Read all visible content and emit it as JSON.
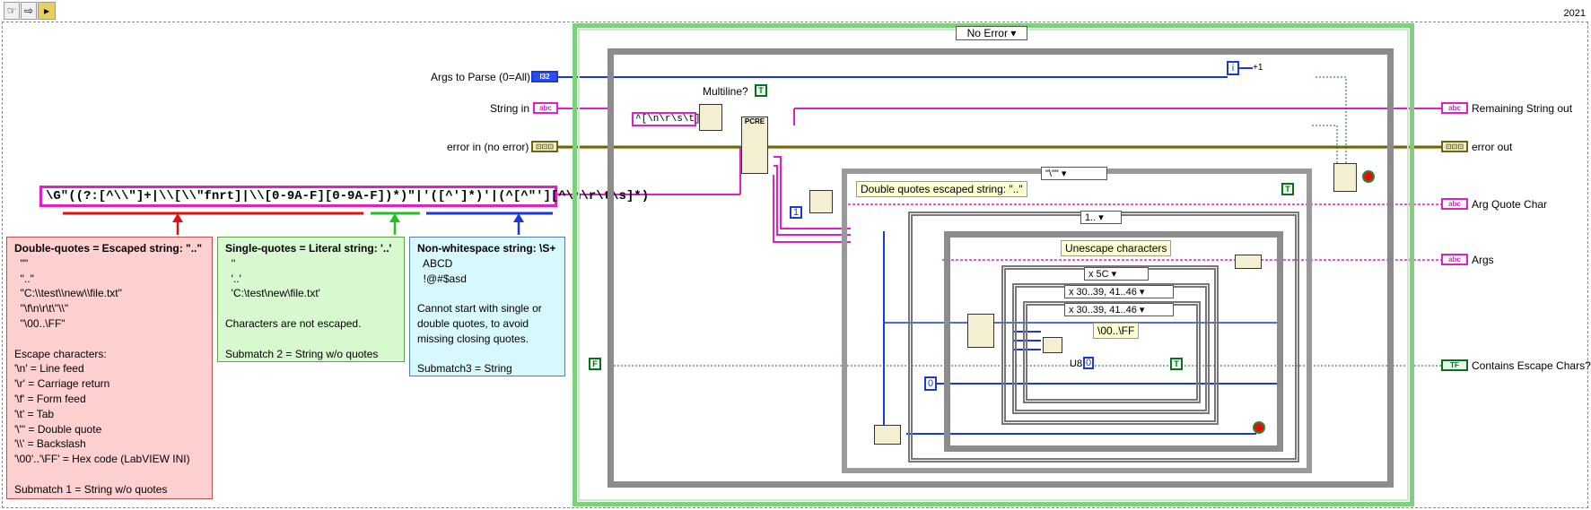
{
  "toolbar": {
    "run_label": "☞",
    "arrow_label": "⇨",
    "icon_label": "▸",
    "year": "2021"
  },
  "controls": {
    "args_label": "Args to Parse (0=All)",
    "args_type": "I32",
    "string_in_label": "String in",
    "string_type": "abc",
    "error_in_label": "error in (no error)",
    "error_type": "⊡⊡⊡"
  },
  "indicators": {
    "remaining_label": "Remaining String out",
    "error_out_label": "error out",
    "quote_char_label": "Arg Quote Char",
    "args_label": "Args",
    "escape_label": "Contains Escape Chars?"
  },
  "regex": "\\G\"((?:[^\\\\\"]+|\\\\[\\\\\"fnrt]|\\\\[0-9A-F][0-9A-F])*)\"|'([^']*)'|(^[^\"'][^\\n\\r\\t\\s]*)",
  "notes": {
    "double": {
      "title": "Double-quotes = Escaped string: \"..\"",
      "body": "  \"\"\n  \"..\"\n  \"C:\\\\test\\\\new\\\\file.txt\"\n  \"\\f\\n\\r\\t\\\"\\\\\"\n  \"\\00..\\FF\"\n\nEscape characters:\n'\\n' = Line feed\n'\\r' = Carriage return\n'\\f' = Form feed\n'\\t' = Tab\n'\\\"' = Double quote\n'\\\\' = Backslash\n'\\00'..'\\FF' = Hex code (LabVIEW INI)\n\nSubmatch 1 = String w/o quotes"
    },
    "single": {
      "title": "Single-quotes = Literal string: '..'",
      "body": "  ''\n  '..'\n  'C:\\test\\new\\file.txt'\n\nCharacters are not escaped.\n\nSubmatch 2 = String w/o quotes"
    },
    "nonws": {
      "title": "Non-whitespace string: \\S+",
      "body": "  ABCD\n  !@#$asd\n\nCannot start with single or\ndouble quotes, to avoid\nmissing closing quotes.\n\nSubmatch3 = String"
    }
  },
  "diagram": {
    "case_selector": "No Error",
    "multiline_label": "Multiline?",
    "multiline_value": "T",
    "whitespace_const": "^[\\n\\r\\s\\t]*",
    "pcre_label": "PCRE",
    "quote_case_selector": "\"\\\"\"",
    "double_quote_comment": "Double quotes escaped string: \"..\"",
    "range_selector": "1..",
    "unescape_comment": "Unescape characters",
    "sel_5c": "x 5C",
    "sel_hex1": "x 30..39, 41..46",
    "sel_hex2": "x 30..39, 41..46",
    "hex_comment": "\\00..\\FF",
    "u8_label": "U8",
    "const_one": "1",
    "const_zero": "0",
    "const_zero_b": "0",
    "const_i": "i",
    "inc_label": "+1",
    "true_const": "T",
    "false_const": "F"
  },
  "colors": {
    "string_wire": "#e020c0",
    "int_wire": "#1a3ad8",
    "error_wire": "#6d6410",
    "bool_wire": "#0d6e20",
    "case_green": "#7fcf7f",
    "arrow_red": "#e01010",
    "arrow_green": "#20c020",
    "arrow_blue": "#1a3ad8"
  }
}
